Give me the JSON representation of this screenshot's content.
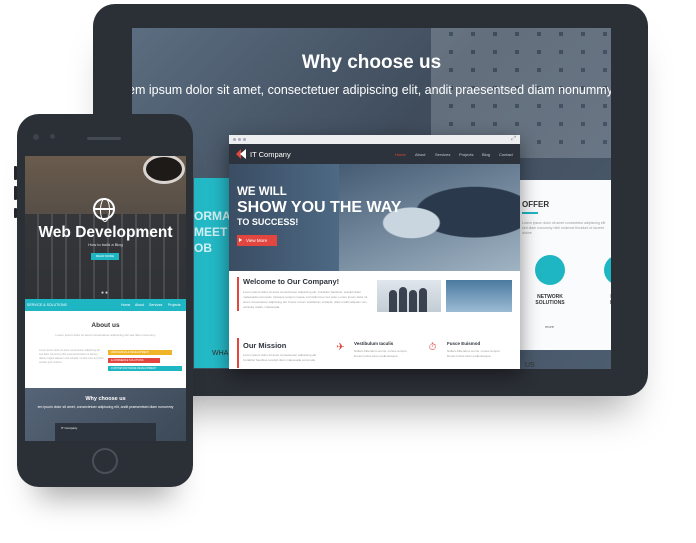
{
  "tablet": {
    "hero": {
      "title": "Why choose us",
      "subtitle": "em ipsum dolor sit amet, consectetuer adipiscing elit, andit praesentsed diam nonummy n"
    },
    "behind_left_text": "ORMA\nMEET\nOB",
    "offer": {
      "title": "OFFER",
      "text": "Lorem ipsum dolor sit amet consectetur adipiscing elit sed diam nonummy nibh euismod tincidunt ut laoreet dolore",
      "item1": "NETWORK\nSOLUTIONS",
      "item2": "DA\nMA",
      "more": "more"
    },
    "what_label": "WHA",
    "us_label": "US",
    "browser": {
      "logo": "IT Company",
      "menu": [
        "Home",
        "About",
        "Services",
        "Projects",
        "Blog",
        "Contact"
      ],
      "hero_line1": "WE WILL",
      "hero_line2": "SHOW YOU THE WAY",
      "hero_line3": "TO SUCCESS!",
      "button": "View More",
      "welcome_title": "Welcome to Our Company!",
      "welcome_text": "Lorem ipsum dolor sit amet consectetuer adipiscing elit. Curabitur faucibus, suscipit diam malesuada commodo. Quisque tempor massa, a tincidunt leo nec ante. Lorem ipsum dolor sit amet consectetuer adipiscing elit. Fusce rutrum vestibulum volutpat, dolor mattis aliquam non vehicula mattis, malesuada.",
      "mission_title": "Our Mission",
      "mission_text": "Lorem ipsum dolor sit amet consectetuer adipiscing elit. Curabitur faucibus suscipit diam malesuada commodo.",
      "feature1_title": "Vestibulum Iaculis",
      "feature1_text": "Nullam bibendum at nisi, cursus tempor. Donec luctus lorem pellentesque.",
      "feature2_title": "Fusce Euismod",
      "feature2_text": "Nullam bibendum at nisi, cursus tempor. Donec luctus lorem pellentesque."
    }
  },
  "phone": {
    "hero_title": "Web Development",
    "hero_sub": "How to build a Blog",
    "hero_button": "READ MORE",
    "nav_logo": "SERVICE & SOLUTIONS",
    "nav_menu": [
      "Home",
      "About",
      "Services",
      "Projects"
    ],
    "about_title": "About us",
    "about_sub": "Lorem ipsum dolor sit amet consectetuer adipiscing elit sed diam nonummy",
    "about_text": "Lorem ipsum dolor sit amet consectetuer adipiscing elit, sed diam nonummy nibh euismod tincidunt ut laoreet dolore magna aliquam erat volutpat. Ut wisi enim ad minim veniam quis nostrud.",
    "bars": [
      "WEB DESIGN & DEVELOPMENT",
      "E-COMMERCE SOLUTIONS",
      "CUSTOM SOFTWARE DEVELOPMENT"
    ],
    "why_title": "Why choose us",
    "why_sub": "em ipsum dolor sit amet, consectetuer adipiscing elit, andit praesentsed diam nonummy",
    "mini_logo": "IT Company"
  },
  "colors": {
    "accent_red": "#e2463f",
    "accent_cyan": "#1fb6c4",
    "device_frame": "#2b2f36"
  }
}
